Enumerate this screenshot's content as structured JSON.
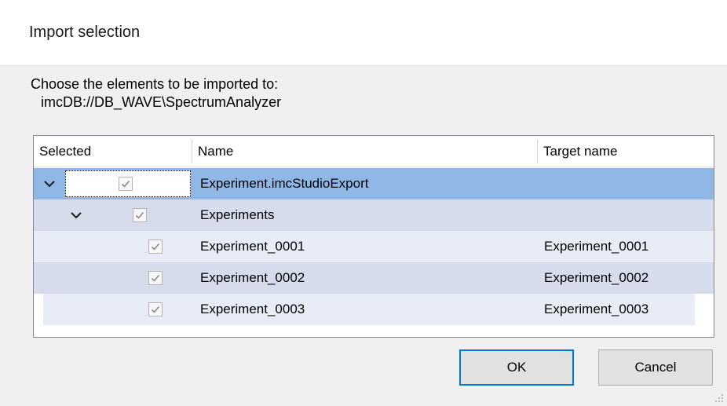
{
  "dialog": {
    "title": "Import selection",
    "prompt": "Choose the elements to be imported to:",
    "target_path": "imcDB://DB_WAVE\\SpectrumAnalyzer"
  },
  "tree": {
    "columns": [
      "Selected",
      "Name",
      "Target name"
    ],
    "rows": [
      {
        "name": "Experiment.imcStudioExport",
        "target": "",
        "checked": true,
        "expanded": true,
        "level": 0,
        "selected": true
      },
      {
        "name": "Experiments",
        "target": "",
        "checked": true,
        "expanded": true,
        "level": 1
      },
      {
        "name": "Experiment_0001",
        "target": "Experiment_0001",
        "checked": true,
        "level": 2
      },
      {
        "name": "Experiment_0002",
        "target": "Experiment_0002",
        "checked": true,
        "level": 2
      },
      {
        "name": "Experiment_0003",
        "target": "Experiment_0003",
        "checked": true,
        "level": 2
      }
    ]
  },
  "buttons": {
    "ok": "OK",
    "cancel": "Cancel"
  },
  "colors": {
    "selected_row": "#90b8e6",
    "alt_row_dark": "#d7dcec",
    "alt_row_light": "#e8ecf6",
    "default_button_border": "#0078d7"
  },
  "icons": {
    "expander": "chevron-down-icon",
    "check": "checkmark-icon",
    "resize": "resize-grip-icon"
  }
}
